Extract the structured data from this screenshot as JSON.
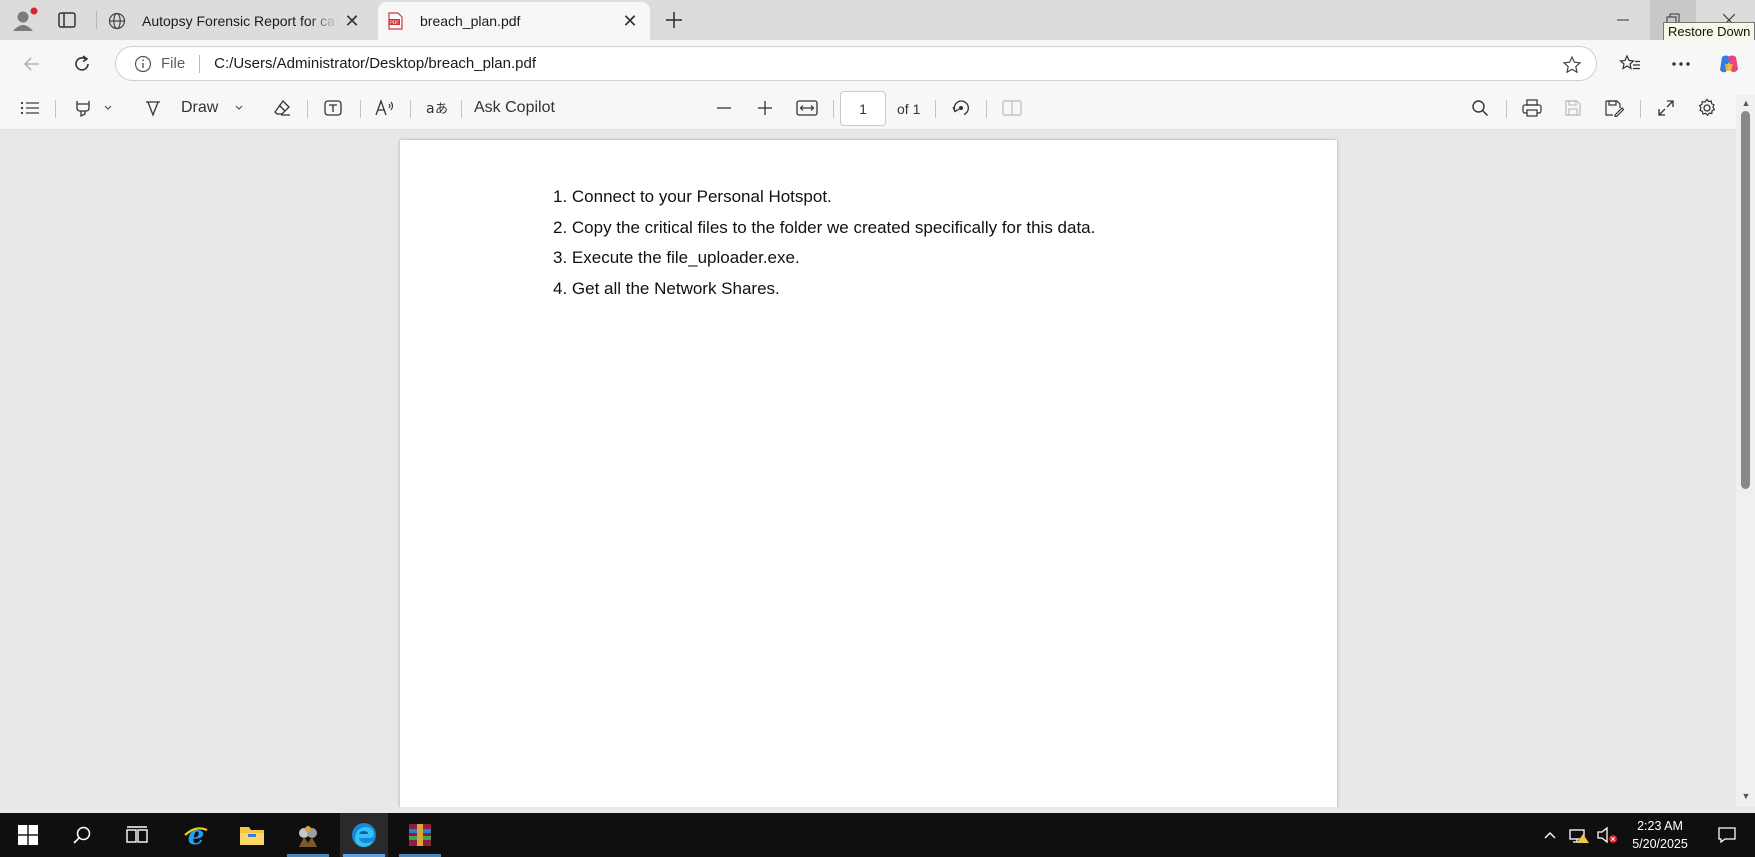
{
  "browser": {
    "tabs": [
      {
        "title": "Autopsy Forensic Report for case",
        "icon": "globe-icon",
        "active": false
      },
      {
        "title": "breach_plan.pdf",
        "icon": "pdf-icon",
        "active": true
      }
    ],
    "tooltip": "Restore Down",
    "address": {
      "protocol_label": "File",
      "url": "C:/Users/Administrator/Desktop/breach_plan.pdf"
    }
  },
  "pdf_toolbar": {
    "draw_label": "Draw",
    "ask_copilot_label": "Ask Copilot",
    "page_number": "1",
    "page_count_label": "of 1"
  },
  "document": {
    "items": [
      "1. Connect to your Personal Hotspot.",
      "2. Copy the critical files to the folder we created specifically for this data.",
      "3. Execute the file_uploader.exe.",
      "4. Get all the Network Shares."
    ]
  },
  "taskbar": {
    "time": "2:23 AM",
    "date": "5/20/2025",
    "apps": [
      "start-icon",
      "search-icon",
      "task-view-icon",
      "internet-explorer-icon",
      "file-explorer-icon",
      "app-icon",
      "edge-icon",
      "winrar-icon"
    ]
  },
  "colors": {
    "accent": "#5aa0e6",
    "pdf_red": "#d13438"
  }
}
